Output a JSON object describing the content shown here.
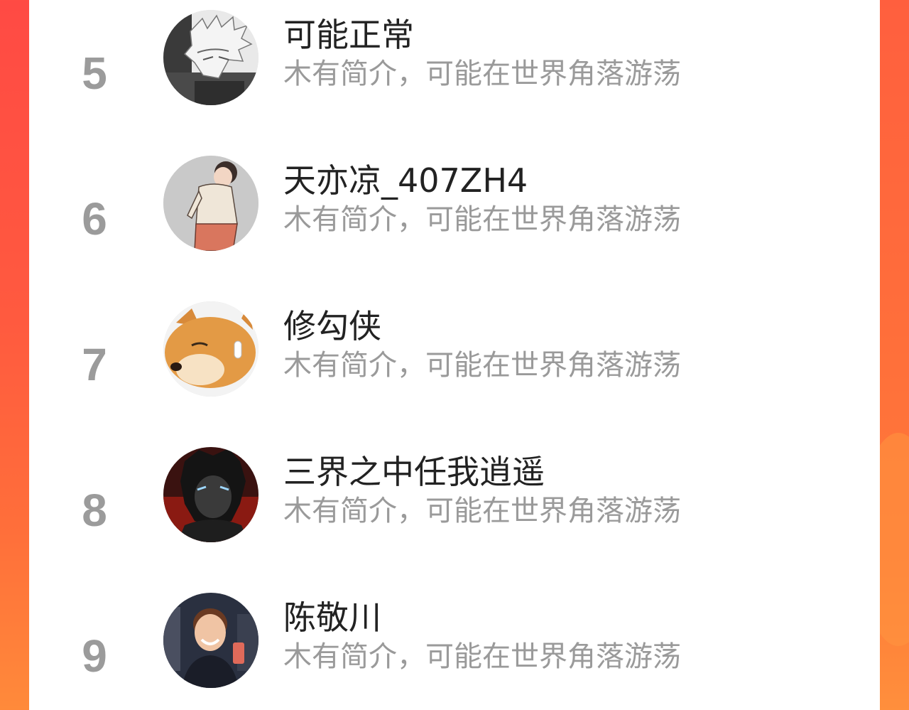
{
  "colors": {
    "background_gradient_start": "#ff4a44",
    "background_gradient_end": "#ff8a3a",
    "rank": "#9b9b9b",
    "name": "#222222",
    "bio": "#9a9a9a",
    "card": "#ffffff"
  },
  "users": [
    {
      "rank": "5",
      "name": "可能正常",
      "bio": "木有简介，可能在世界角落游荡",
      "avatar_icon": "anime-white-hair-avatar"
    },
    {
      "rank": "6",
      "name": "天亦凉_407ZH4",
      "bio": "木有简介，可能在世界角落游荡",
      "avatar_icon": "cartoon-boy-avatar"
    },
    {
      "rank": "7",
      "name": "修勾侠",
      "bio": "木有简介，可能在世界角落游荡",
      "avatar_icon": "shiba-dog-avatar"
    },
    {
      "rank": "8",
      "name": "三界之中任我逍遥",
      "bio": "木有简介，可能在世界角落游荡",
      "avatar_icon": "dark-anime-avatar"
    },
    {
      "rank": "9",
      "name": "陈敬川",
      "bio": "木有简介，可能在世界角落游荡",
      "avatar_icon": "smiling-boy-photo-avatar"
    }
  ]
}
